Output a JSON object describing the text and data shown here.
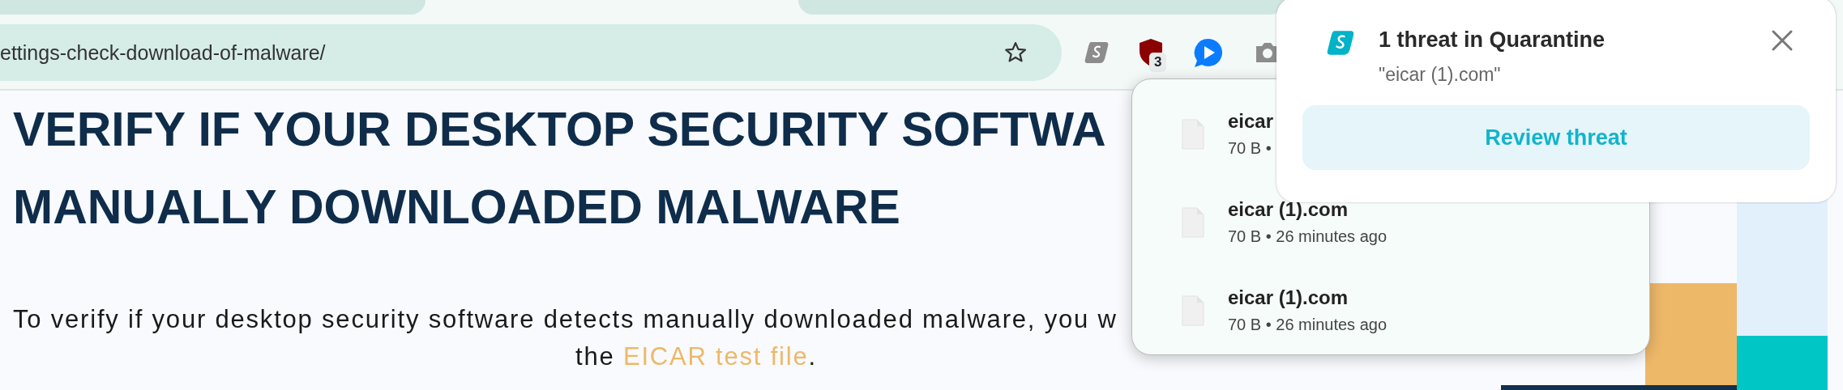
{
  "address_bar": {
    "url": "ettings-check-download-of-malware/"
  },
  "toolbar": {
    "extension_badge": "3"
  },
  "article": {
    "headline_lines": [
      "VERIFY IF YOUR DESKTOP SECURITY SOFTWA",
      "MANUALLY DOWNLOADED MALWARE"
    ],
    "paragraph_line_1": "To verify if your desktop security software detects manually downloaded malware, you w",
    "paragraph_line_2": {
      "before": "the ",
      "link": "EICAR test file",
      "after": "."
    }
  },
  "downloads": [
    {
      "name": "eicar",
      "meta": "70 B •"
    },
    {
      "name": "eicar (1).com",
      "meta": "70 B • 26 minutes ago"
    },
    {
      "name": "eicar (1).com",
      "meta": "70 B • 26 minutes ago"
    }
  ],
  "notification": {
    "title": "1 threat in Quarantine",
    "subtitle": "\"eicar (1).com\"",
    "button": "Review threat"
  }
}
